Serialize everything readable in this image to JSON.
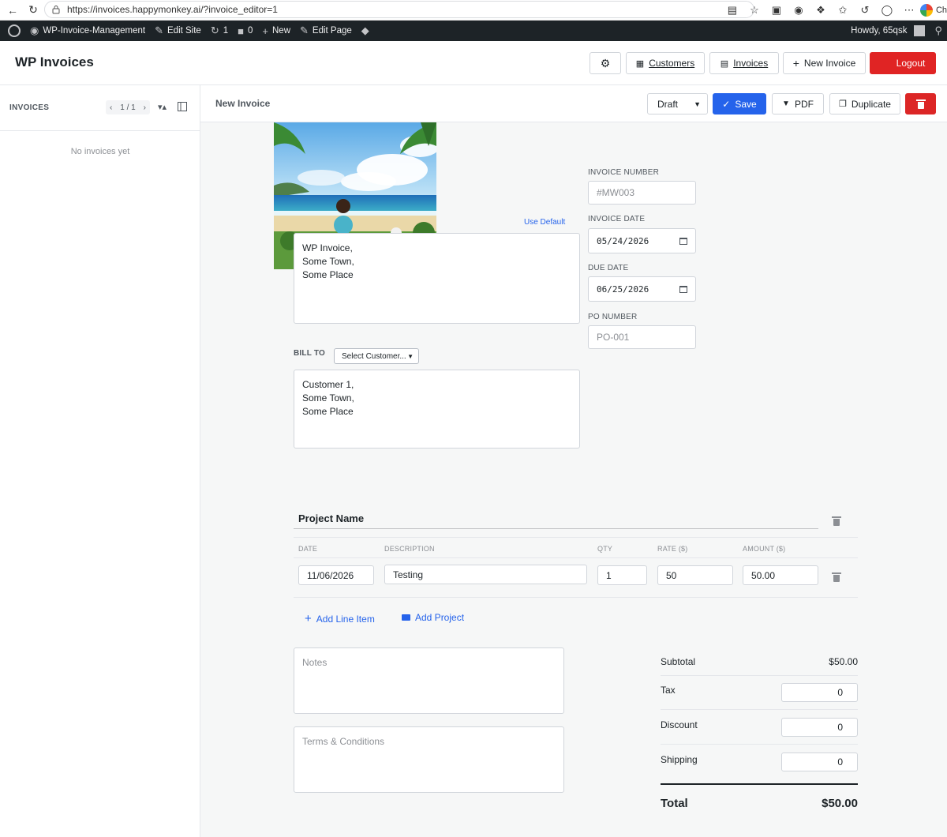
{
  "browser": {
    "url": "https://invoices.happymonkey.ai/?invoice_editor=1",
    "profile_label": "Ch"
  },
  "wp_bar": {
    "site_name": "WP-Invoice-Management",
    "edit_site": "Edit Site",
    "updates_count": "1",
    "comments_count": "0",
    "new_label": "New",
    "edit_page": "Edit Page",
    "howdy": "Howdy, 65qsk"
  },
  "header": {
    "title": "WP Invoices",
    "customers": "Customers",
    "invoices": "Invoices",
    "new_invoice": "New Invoice",
    "logout": "Logout"
  },
  "sidebar": {
    "title": "INVOICES",
    "pager": "1 / 1",
    "empty": "No invoices yet"
  },
  "toolbar": {
    "title": "New Invoice",
    "status": "Draft",
    "save": "Save",
    "pdf": "PDF",
    "duplicate": "Duplicate"
  },
  "invoice": {
    "use_default": "Use Default",
    "from_address": "WP Invoice,\nSome Town,\nSome Place",
    "invoice_number_label": "INVOICE NUMBER",
    "invoice_number_placeholder": "#MW003",
    "invoice_date_label": "INVOICE DATE",
    "invoice_date": "05/24/2026",
    "due_date_label": "DUE DATE",
    "due_date": "06/25/2026",
    "po_label": "PO NUMBER",
    "po_placeholder": "PO-001",
    "bill_to_label": "BILL TO",
    "customer_select": "Select Customer...",
    "bill_to_address": "Customer 1,\nSome Town,\nSome Place"
  },
  "project": {
    "name": "Project Name",
    "columns": {
      "date": "DATE",
      "description": "DESCRIPTION",
      "qty": "QTY",
      "rate": "RATE ($)",
      "amount": "AMOUNT ($)"
    },
    "line_items": [
      {
        "date": "11/06/2026",
        "description": "Testing",
        "qty": "1",
        "rate": "50",
        "amount": "50.00"
      }
    ],
    "add_line_item": "Add Line Item",
    "add_project": "Add Project"
  },
  "notes": {
    "notes_placeholder": "Notes",
    "terms_placeholder": "Terms & Conditions"
  },
  "totals": {
    "subtotal_label": "Subtotal",
    "subtotal": "$50.00",
    "tax_label": "Tax",
    "tax": "0",
    "discount_label": "Discount",
    "discount": "0",
    "shipping_label": "Shipping",
    "shipping": "0",
    "total_label": "Total",
    "total": "$50.00"
  },
  "colors": {
    "primary": "#2563eb",
    "danger": "#e02424",
    "admin_bar": "#1d2327"
  }
}
